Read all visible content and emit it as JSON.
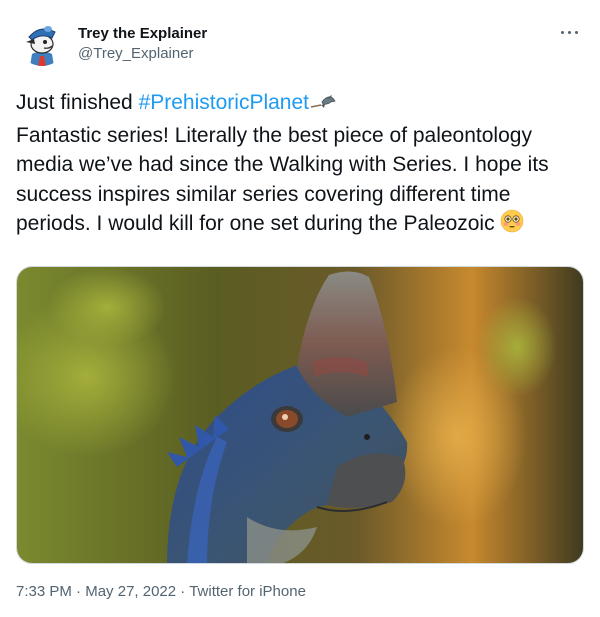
{
  "user": {
    "display_name": "Trey the Explainer",
    "handle": "@Trey_Explainer",
    "avatar_icon": "cartoon-avatar-icon"
  },
  "menu": {
    "icon": "more-options-icon"
  },
  "tweet": {
    "prefix": "Just finished ",
    "hashtag": "#PrehistoricPlanet",
    "hashtag_icon": "prehistoric-planet-icon",
    "body": "Fantastic series! Literally the best piece of paleontology media we’ve had since the Walking with Series. I hope its success inspires similar series covering different time periods. I would kill for one set during the Paleozoic",
    "emoji_icon": "flushed-face-emoji",
    "image_icon": "dinosaur-photo"
  },
  "meta": {
    "time": "7:33 PM",
    "separator": "·",
    "date": "May 27, 2022",
    "source": "Twitter for iPhone"
  },
  "colors": {
    "link": "#1d9bf0",
    "secondary_text": "#536471",
    "primary_text": "#0f1419"
  }
}
